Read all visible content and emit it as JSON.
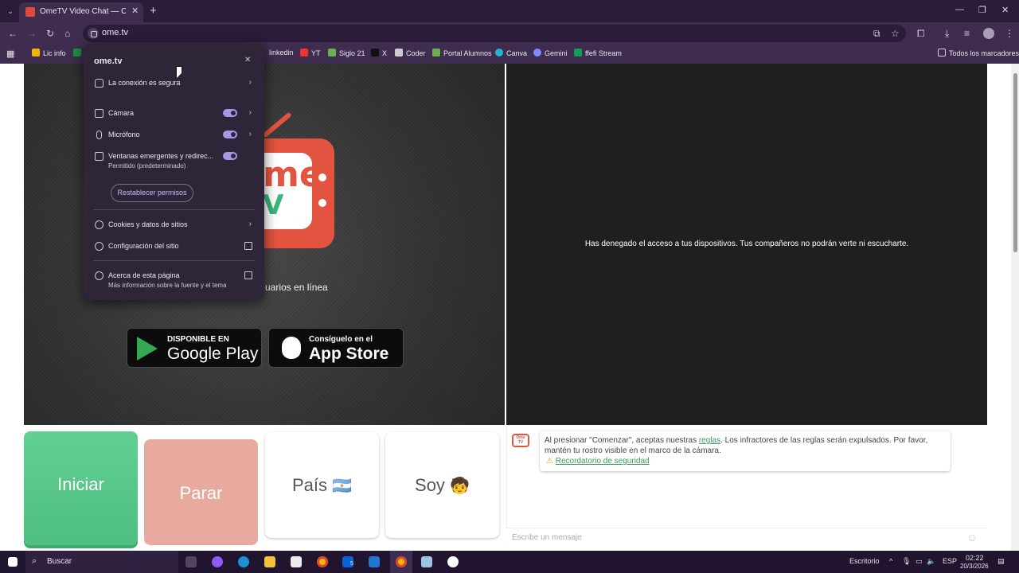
{
  "browser": {
    "tab_title": "OmeTV Video Chat — Omegle",
    "url": "ome.tv",
    "bookmarks": [
      "Lic info",
      "linkedin",
      "YT",
      "Siglo 21",
      "X",
      "Coder",
      "Portal Alumnos",
      "Canva",
      "Gemini",
      "ffefi Stream"
    ],
    "all_bookmarks": "Todos los marcadores"
  },
  "popup": {
    "site": "ome.tv",
    "connection": "La conexión es segura",
    "camera": "Cámara",
    "microphone": "Micrófono",
    "popups": "Ventanas emergentes y redirec...",
    "popups_sub": "Permitido (predeterminado)",
    "reset": "Restablecer permisos",
    "cookies": "Cookies y datos de sitios",
    "site_settings": "Configuración del sitio",
    "about": "Acerca de esta página",
    "about_sub": "Más información sobre la fuente y el tema"
  },
  "page": {
    "online_text": "uarios en línea",
    "google_play_small": "DISPONIBLE EN",
    "google_play_big": "Google Play",
    "app_store_small": "Consíguelo en el",
    "app_store_big": "App Store",
    "denied_message": "Has denegado el acceso a tus dispositivos. Tus compañeros no podrán verte ni escucharte.",
    "buttons": {
      "start": "Iniciar",
      "stop": "Parar",
      "country": "País",
      "country_flag": "🇦🇷",
      "me": "Soy",
      "me_emoji": "🧒"
    },
    "notice_prefix": "Al presionar \"Comenzar\", aceptas nuestras ",
    "notice_link": "reglas",
    "notice_suffix": ". Los infractores de las reglas serán expulsados. Por favor, mantén tu rostro visible en el marco de la cámara.",
    "safety_link": "Recordatorio de seguridad",
    "message_placeholder": "Escribe un mensaje",
    "logo_mark": "Ome TV"
  },
  "taskbar": {
    "search": "Buscar",
    "desktop": "Escritorio",
    "lang": "ESP",
    "time": "02:22",
    "date": "20/3/2026",
    "badge": "5"
  },
  "colors": {
    "start_button": "#5cc98a",
    "stop_button": "#e8a99e",
    "toggle_on": "#a996e6"
  }
}
